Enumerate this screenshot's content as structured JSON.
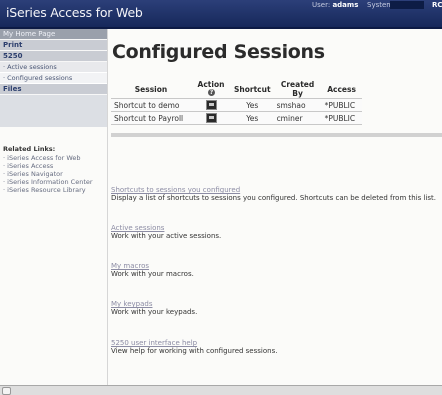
{
  "header": {
    "title": "iSeries Access for Web",
    "user_label": "User:",
    "user_value": "adams",
    "system_label": "System",
    "system_value": "RC"
  },
  "nav": {
    "home": "My Home Page",
    "print": "Print",
    "s5250": "5250",
    "active_sessions": "· Active sessions",
    "configured_sessions": "· Configured sessions",
    "files": "Files"
  },
  "related": {
    "title": "Related Links:",
    "items": [
      "· iSeries Access for Web",
      "· iSeries Access",
      "· iSeries Navigator",
      "· iSeries Information Center",
      "· iSeries Resource Library"
    ]
  },
  "page": {
    "title": "Configured Sessions"
  },
  "table": {
    "headers": {
      "session": "Session",
      "action": "Action",
      "shortcut": "Shortcut",
      "created_by": "Created By",
      "access": "Access"
    },
    "help_icon": "?",
    "rows": [
      {
        "session": "Shortcut to demo",
        "shortcut": "Yes",
        "created_by": "smshao",
        "access": "*PUBLIC"
      },
      {
        "session": "Shortcut to Payroll",
        "shortcut": "Yes",
        "created_by": "cminer",
        "access": "*PUBLIC"
      }
    ]
  },
  "links": [
    {
      "link": "Shortcuts to sessions you configured",
      "desc": "Display a list of shortcuts to sessions you configured. Shortcuts can be deleted from this list."
    },
    {
      "link": "Active sessions",
      "desc": "Work with your active sessions."
    },
    {
      "link": "My macros",
      "desc": "Work with your macros."
    },
    {
      "link": "My keypads",
      "desc": "Work with your keypads."
    },
    {
      "link": "5250 user interface help",
      "desc": "View help for working with configured sessions."
    }
  ]
}
